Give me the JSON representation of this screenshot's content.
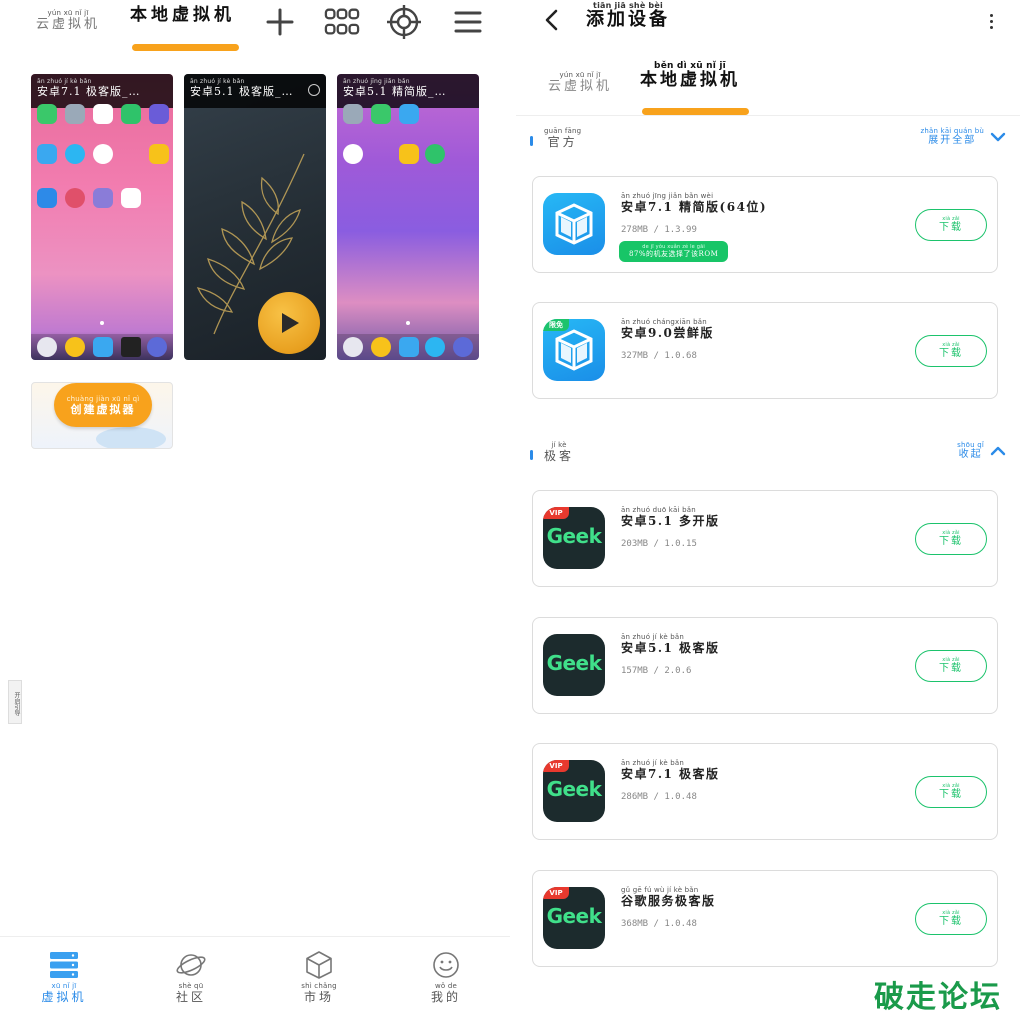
{
  "left": {
    "tabs": {
      "cloud": {
        "py": "yún xū nǐ jī",
        "hz": "云虚拟机"
      },
      "local": {
        "py": "",
        "hz": "本地虚拟机"
      }
    },
    "vms": [
      {
        "py": "ān zhuó      jí kè bǎn",
        "hz": "安卓7.1 极客版_…"
      },
      {
        "py": "ān zhuó      jí kè bǎn",
        "hz": "安卓5.1 极客版_…"
      },
      {
        "py": "ān zhuó      jīng jiǎn bǎn",
        "hz": "安卓5.1 精简版_…"
      }
    ],
    "create": {
      "py": "chuàng jiàn xū nǐ qì",
      "hz": "创建虚拟器"
    },
    "side_tag": "开启引导",
    "nav": [
      {
        "py": "xū nǐ jī",
        "hz": "虚拟机",
        "icon": "server-icon"
      },
      {
        "py": "shè qū",
        "hz": "社区",
        "icon": "planet-icon"
      },
      {
        "py": "shì chǎng",
        "hz": "市场",
        "icon": "cube-icon"
      },
      {
        "py": "wǒ de",
        "hz": "我的",
        "icon": "smile-icon"
      }
    ]
  },
  "right": {
    "header": {
      "py": "tiān jiā shè bèi",
      "hz": "添加设备"
    },
    "tabs": {
      "cloud": {
        "py": "yún xū nǐ jī",
        "hz": "云虚拟机"
      },
      "local": {
        "py": "běn dì xū nǐ jī",
        "hz": "本地虚拟机"
      }
    },
    "sections": [
      {
        "py": "guān fāng",
        "hz": "官方",
        "action_py": "zhǎn kāi quán bù",
        "action_hz": "展开全部"
      },
      {
        "py": "jí kè",
        "hz": "极客",
        "action_py": "shōu qǐ",
        "action_hz": "收起"
      }
    ],
    "download": {
      "py": "xià zǎi",
      "hz": "下载"
    },
    "official_apps": [
      {
        "py": "ān zhuó      jīng jiǎn bǎn      wèi",
        "hz": "安卓7.1 精简版(64位)",
        "meta": "278MB / 1.3.99",
        "pill_py": "de jī yǒu xuǎn zé le gāi",
        "pill_hz": "87%的机友选择了该ROM",
        "badge": ""
      },
      {
        "py": "ān zhuó      chángxiān bǎn",
        "hz": "安卓9.0尝鲜版",
        "meta": "327MB / 1.0.68",
        "badge": "限免"
      }
    ],
    "geek_apps": [
      {
        "py": "ān zhuó      duō kāi bǎn",
        "hz": "安卓5.1 多开版",
        "meta": "203MB / 1.0.15",
        "badge": "VIP"
      },
      {
        "py": "ān zhuó      jí kè bǎn",
        "hz": "安卓5.1 极客版",
        "meta": "157MB / 2.0.6",
        "badge": ""
      },
      {
        "py": "ān zhuó      jí kè bǎn",
        "hz": "安卓7.1 极客版",
        "meta": "286MB / 1.0.48",
        "badge": "VIP"
      },
      {
        "py": "gǔ gē fú wù jí kè bǎn",
        "hz": "谷歌服务极客版",
        "meta": "368MB / 1.0.48",
        "badge": "VIP"
      }
    ],
    "geek_logo_text": "Geek"
  },
  "watermark": "破走论坛",
  "colors": {
    "accent": "#f8a21c",
    "blue": "#2b8be8",
    "green": "#1cc36c"
  }
}
